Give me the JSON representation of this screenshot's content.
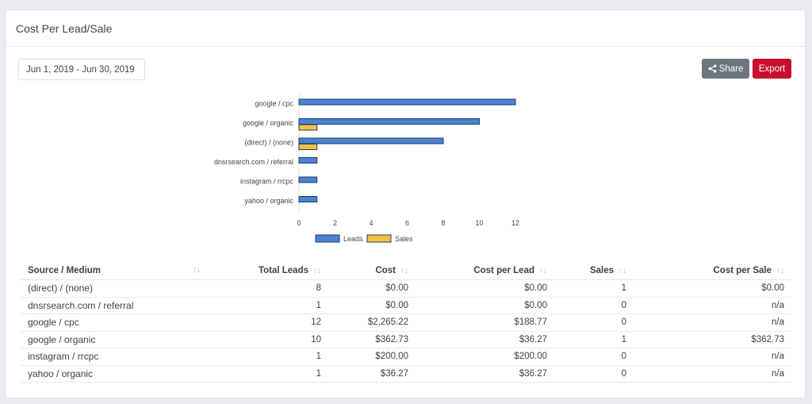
{
  "card": {
    "title": "Cost Per Lead/Sale"
  },
  "date_range": "Jun 1, 2019 - Jun 30, 2019",
  "buttons": {
    "share": "Share",
    "export": "Export"
  },
  "icons": {
    "share": "share-icon",
    "sort": "sort-icon"
  },
  "colors": {
    "leads": "#4a83d0",
    "sales": "#f5c23e",
    "export": "#c8102e",
    "share": "#6c757d"
  },
  "chart_data": {
    "type": "bar",
    "orientation": "horizontal",
    "categories": [
      "google / cpc",
      "google / organic",
      "(direct) / (none)",
      "dnsrsearch.com / referral",
      "instagram / rrcpc",
      "yahoo / organic"
    ],
    "series": [
      {
        "name": "Leads",
        "values": [
          12,
          10,
          8,
          1,
          1,
          1
        ]
      },
      {
        "name": "Sales",
        "values": [
          0,
          1,
          1,
          0,
          0,
          0
        ]
      }
    ],
    "xticks": [
      "0",
      "2",
      "4",
      "6",
      "8",
      "10",
      "12"
    ],
    "xlim": [
      0,
      12
    ],
    "legend_position": "bottom"
  },
  "table": {
    "columns": [
      "Source / Medium",
      "Total Leads",
      "Cost",
      "Cost per Lead",
      "Sales",
      "Cost per Sale"
    ],
    "sort_glyph": "↑↓",
    "rows": [
      [
        "(direct) / (none)",
        "8",
        "$0.00",
        "$0.00",
        "1",
        "$0.00"
      ],
      [
        "dnsrsearch.com / referral",
        "1",
        "$0.00",
        "$0.00",
        "0",
        "n/a"
      ],
      [
        "google / cpc",
        "12",
        "$2,265.22",
        "$188.77",
        "0",
        "n/a"
      ],
      [
        "google / organic",
        "10",
        "$362.73",
        "$36.27",
        "1",
        "$362.73"
      ],
      [
        "instagram / rrcpc",
        "1",
        "$200.00",
        "$200.00",
        "0",
        "n/a"
      ],
      [
        "yahoo / organic",
        "1",
        "$36.27",
        "$36.27",
        "0",
        "n/a"
      ]
    ]
  }
}
